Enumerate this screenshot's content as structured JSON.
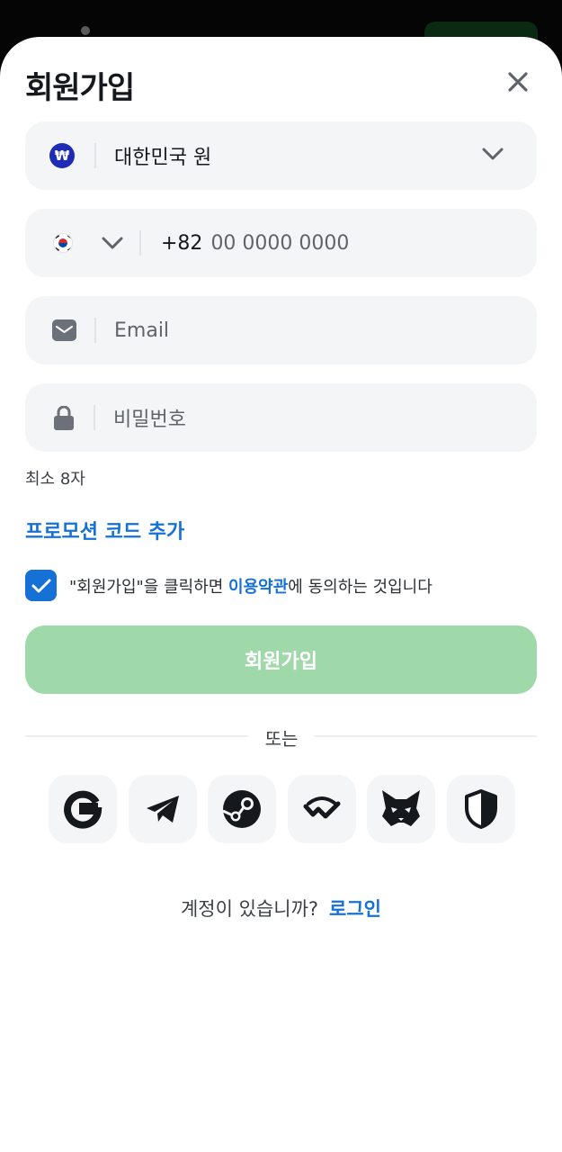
{
  "header": {
    "title": "회원가입"
  },
  "currency": {
    "icon": "won-coin-icon",
    "symbol": "₩",
    "value": "대한민국 원"
  },
  "phone": {
    "country_icon": "south-korea-flag-icon",
    "prefix": "+82",
    "placeholder": "00 0000 0000"
  },
  "email": {
    "placeholder": "Email"
  },
  "password": {
    "placeholder": "비밀번호",
    "hint": "최소 8자"
  },
  "promo": {
    "label": "프로모션 코드 추가"
  },
  "terms": {
    "checked": true,
    "prefix": "\"회원가입\"을 클릭하면 ",
    "link": "이용약관",
    "suffix": "에 동의하는 것입니다"
  },
  "submit": {
    "label": "회원가입"
  },
  "divider": {
    "label": "또는"
  },
  "social": [
    {
      "icon": "google-icon"
    },
    {
      "icon": "telegram-icon"
    },
    {
      "icon": "steam-icon"
    },
    {
      "icon": "walletconnect-icon"
    },
    {
      "icon": "metamask-fox-icon"
    },
    {
      "icon": "shield-icon"
    }
  ],
  "footer": {
    "question": "계정이 있습니까?",
    "login": "로그인"
  },
  "colors": {
    "accent": "#1571d6",
    "submit_disabled": "#9fd8a9",
    "field_bg": "#f4f5f6"
  }
}
